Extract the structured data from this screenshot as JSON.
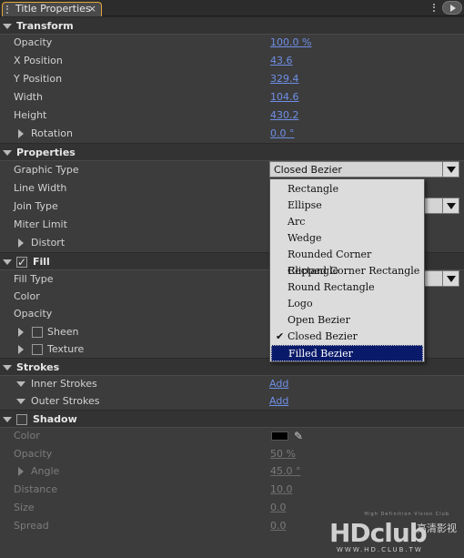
{
  "tab": {
    "title": "Title Properties",
    "close": "×"
  },
  "sections": {
    "transform": "Transform",
    "properties": "Properties",
    "fill": "Fill",
    "strokes": "Strokes",
    "shadow": "Shadow"
  },
  "transform": {
    "opacity_label": "Opacity",
    "opacity_value": "100.0 %",
    "x_label": "X Position",
    "x_value": "43.6",
    "y_label": "Y Position",
    "y_value": "329.4",
    "width_label": "Width",
    "width_value": "104.6",
    "height_label": "Height",
    "height_value": "430.2",
    "rotation_label": "Rotation",
    "rotation_value": "0.0 °"
  },
  "properties": {
    "graphic_type_label": "Graphic Type",
    "graphic_type_value": "Closed Bezier",
    "line_width_label": "Line Width",
    "join_type_label": "Join Type",
    "miter_limit_label": "Miter Limit",
    "distort_label": "Distort"
  },
  "fill": {
    "fill_type_label": "Fill Type",
    "color_label": "Color",
    "opacity_label": "Opacity",
    "sheen_label": "Sheen",
    "texture_label": "Texture"
  },
  "strokes": {
    "inner_label": "Inner Strokes",
    "inner_add": "Add",
    "outer_label": "Outer Strokes",
    "outer_add": "Add"
  },
  "shadow": {
    "color_label": "Color",
    "opacity_label": "Opacity",
    "opacity_value": "50 %",
    "angle_label": "Angle",
    "angle_value": "45.0 °",
    "distance_label": "Distance",
    "distance_value": "10.0",
    "size_label": "Size",
    "size_value": "0.0",
    "spread_label": "Spread",
    "spread_value": "0.0"
  },
  "menu": {
    "items": [
      "Rectangle",
      "Ellipse",
      "Arc",
      "Wedge",
      "Rounded Corner Rectangle",
      "Clipped Corner Rectangle",
      "Round Rectangle",
      "Logo",
      "Open Bezier",
      "Closed Bezier",
      "Filled Bezier"
    ],
    "checked": "Closed Bezier",
    "highlighted": "Filled Bezier"
  },
  "watermark": {
    "tagline": "High Definition Vision Club",
    "logo_text": "HDclub",
    "cn_text": "高清影视",
    "url": "WWW.HD.CLUB.TW"
  },
  "colors": {
    "accent_link": "#6f8fe6",
    "tab_border": "#e2a53a",
    "menu_highlight": "#0a1a6a"
  }
}
